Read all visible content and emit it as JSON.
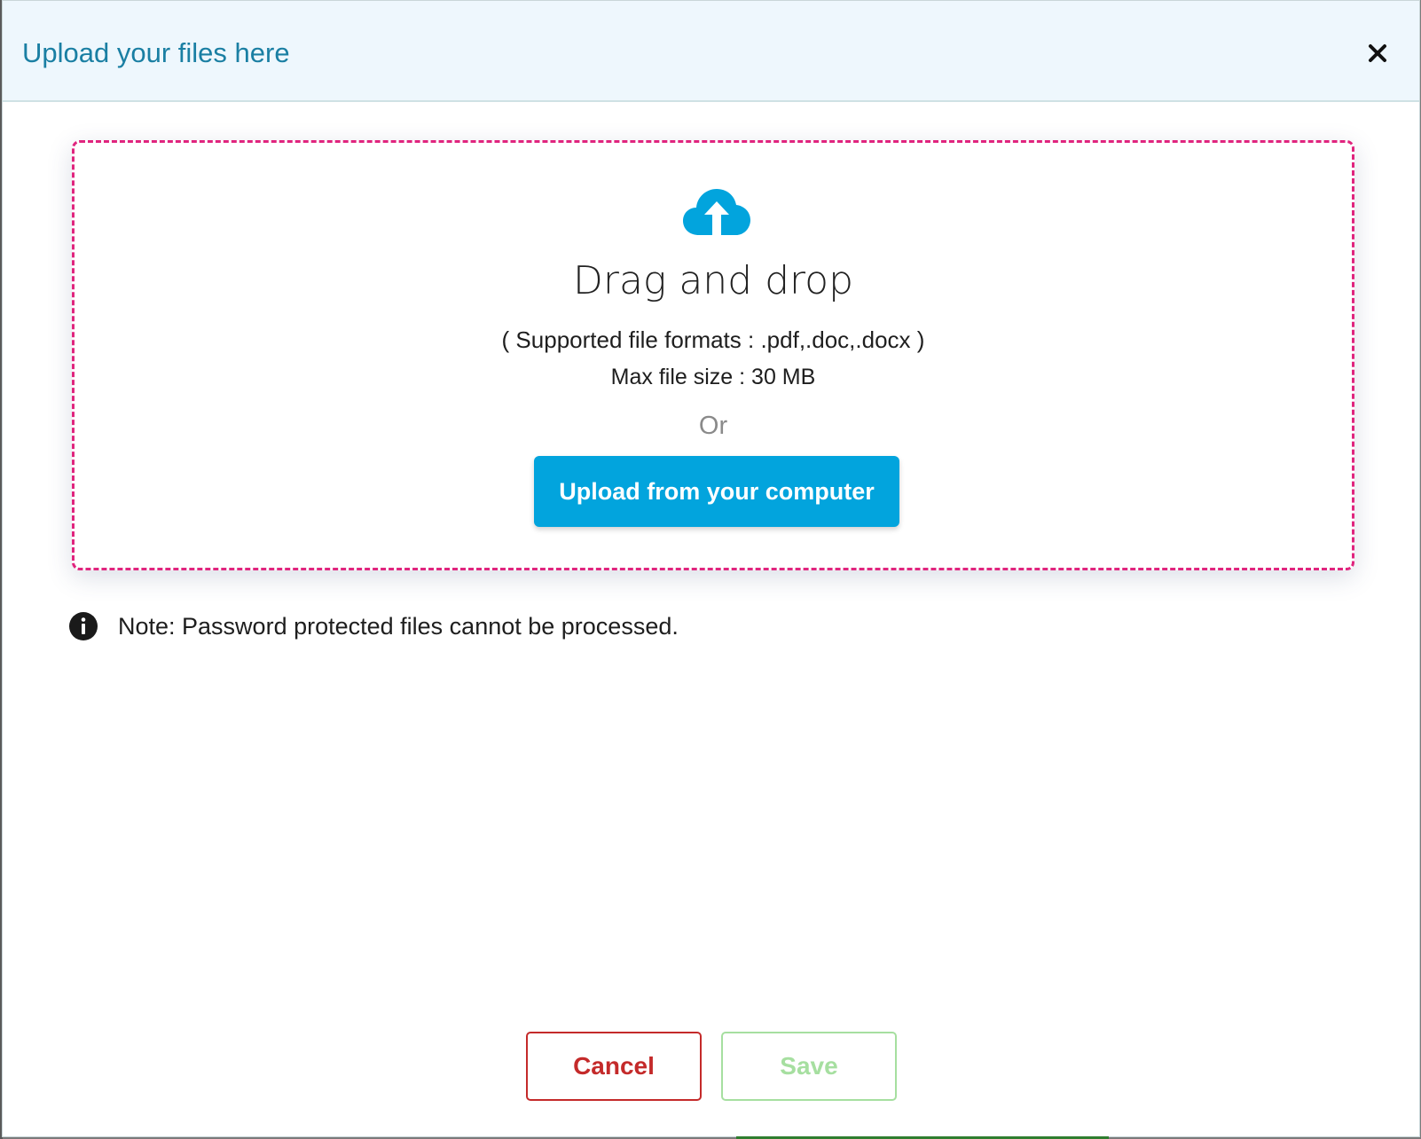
{
  "dialog": {
    "title": "Upload your files here",
    "close_icon": "close-icon"
  },
  "dropzone": {
    "icon": "cloud-upload-icon",
    "title": "Drag and drop",
    "formats": "( Supported file formats : .pdf,.doc,.docx )",
    "max_size": "Max file size : 30 MB",
    "or": "Or",
    "upload_button": "Upload from your computer"
  },
  "note": {
    "icon": "info-icon",
    "text": "Note: Password protected files cannot be processed."
  },
  "footer": {
    "cancel_label": "Cancel",
    "save_label": "Save"
  },
  "colors": {
    "title": "#1a7fa3",
    "dropzone_border": "#e0257e",
    "upload_button": "#02a4dd",
    "cancel": "#c42a2a",
    "save_disabled": "#a6dfa0"
  }
}
